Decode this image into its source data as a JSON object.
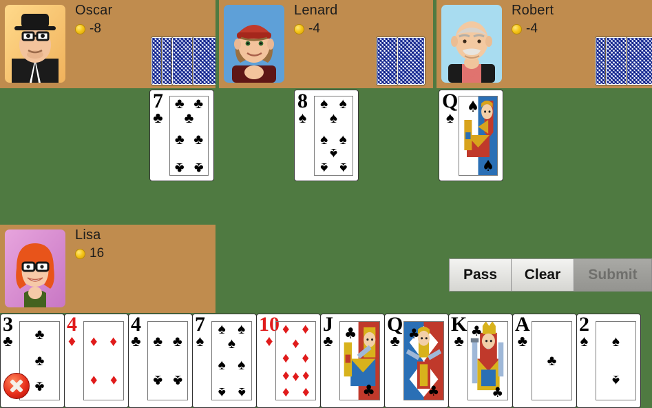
{
  "colors": {
    "table_felt": "#4f7a41",
    "player_panel": "#c08c4e",
    "card_face": "#ffffff",
    "red_suit": "#e01b1b",
    "black_suit": "#000000",
    "button_face": "#e3e3e0",
    "button_disabled": "#9d9d99",
    "badge_red": "#e8301c"
  },
  "players": [
    {
      "id": "oscar",
      "name": "Oscar",
      "coin_icon": "coin-icon",
      "score": "-8",
      "facedown_cards": 4
    },
    {
      "id": "lenard",
      "name": "Lenard",
      "coin_icon": "coin-icon",
      "score": "-4",
      "facedown_cards": 2
    },
    {
      "id": "robert",
      "name": "Robert",
      "coin_icon": "coin-icon",
      "score": "-4",
      "facedown_cards": 3
    },
    {
      "id": "lisa",
      "name": "Lisa",
      "coin_icon": "coin-icon",
      "score": "16",
      "facedown_cards": 0
    }
  ],
  "table_cards": [
    {
      "rank": "7",
      "suit": "clubs",
      "suit_glyph": "♣",
      "color": "black",
      "played_by": "Oscar"
    },
    {
      "rank": "8",
      "suit": "spades",
      "suit_glyph": "♠",
      "color": "black",
      "played_by": "Lenard"
    },
    {
      "rank": "Q",
      "suit": "spades",
      "suit_glyph": "♠",
      "color": "black",
      "played_by": "Robert"
    }
  ],
  "actions": {
    "pass_label": "Pass",
    "clear_label": "Clear",
    "submit_label": "Submit",
    "submit_enabled": false
  },
  "hand": {
    "card_count": 10,
    "cards": [
      {
        "rank": "3",
        "suit": "clubs",
        "suit_glyph": "♣",
        "color": "black",
        "blocked": true,
        "badge": "blocked-x-icon"
      },
      {
        "rank": "4",
        "suit": "diamonds",
        "suit_glyph": "♦",
        "color": "red",
        "blocked": false
      },
      {
        "rank": "4",
        "suit": "clubs",
        "suit_glyph": "♣",
        "color": "black",
        "blocked": false
      },
      {
        "rank": "7",
        "suit": "spades",
        "suit_glyph": "♠",
        "color": "black",
        "blocked": false
      },
      {
        "rank": "10",
        "suit": "diamonds",
        "suit_glyph": "♦",
        "color": "red",
        "blocked": false
      },
      {
        "rank": "J",
        "suit": "clubs",
        "suit_glyph": "♣",
        "color": "black",
        "blocked": false
      },
      {
        "rank": "Q",
        "suit": "clubs",
        "suit_glyph": "♣",
        "color": "black",
        "blocked": false
      },
      {
        "rank": "K",
        "suit": "clubs",
        "suit_glyph": "♣",
        "color": "black",
        "blocked": false
      },
      {
        "rank": "A",
        "suit": "clubs",
        "suit_glyph": "♣",
        "color": "black",
        "blocked": false
      },
      {
        "rank": "2",
        "suit": "spades",
        "suit_glyph": "♠",
        "color": "black",
        "blocked": false
      }
    ]
  }
}
